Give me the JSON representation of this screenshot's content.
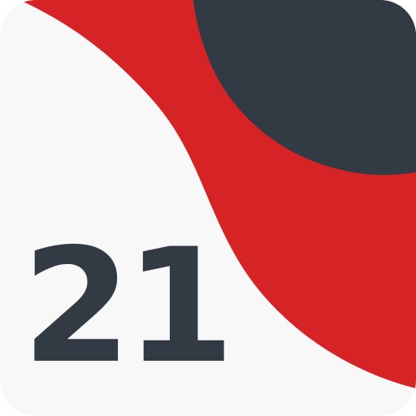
{
  "icon": {
    "number_text": "21",
    "colors": {
      "background": "#F8F8F8",
      "red": "#D62426",
      "dark": "#323A44"
    }
  }
}
